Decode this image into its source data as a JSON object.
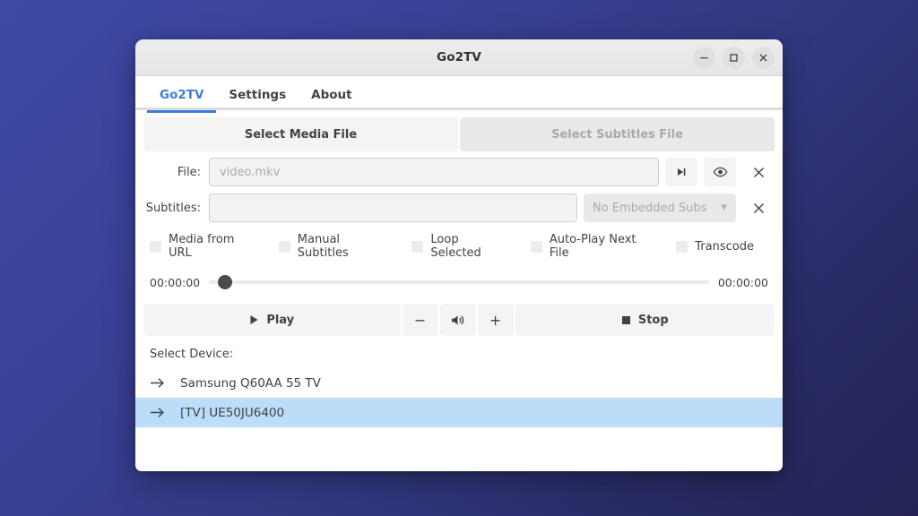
{
  "window": {
    "title": "Go2TV",
    "controls": [
      {
        "name": "minimize",
        "glyph": "minus"
      },
      {
        "name": "maximize",
        "glyph": "square"
      },
      {
        "name": "close",
        "glyph": "x"
      }
    ]
  },
  "tabs": [
    {
      "label": "Go2TV",
      "active": true
    },
    {
      "label": "Settings",
      "active": false
    },
    {
      "label": "About",
      "active": false
    }
  ],
  "segmented": {
    "media_button": "Select Media File",
    "subtitles_button": "Select Subtitles File"
  },
  "file_row": {
    "label": "File:",
    "value": "",
    "placeholder": "video.mkv",
    "buttons": [
      {
        "name": "skip-next-icon",
        "title": "skip-next"
      },
      {
        "name": "eye-icon",
        "title": "preview"
      },
      {
        "name": "clear-icon",
        "title": "clear"
      }
    ]
  },
  "subtitles_row": {
    "label": "Subtitles:",
    "value": "",
    "placeholder": "",
    "embedded_select": "No Embedded Subs",
    "clear_icon": "clear-icon"
  },
  "checkboxes": [
    {
      "label": "Media from URL",
      "checked": false
    },
    {
      "label": "Manual Subtitles",
      "checked": false
    },
    {
      "label": "Loop Selected",
      "checked": false
    },
    {
      "label": "Auto-Play Next File",
      "checked": false
    },
    {
      "label": "Transcode",
      "checked": false
    }
  ],
  "timeline": {
    "elapsed": "00:00:00",
    "total": "00:00:00",
    "position_percent": 0
  },
  "playback": {
    "play_label": "Play",
    "stop_label": "Stop",
    "volume_down": "−",
    "volume_icon": "volume-icon",
    "volume_up": "+"
  },
  "devices": {
    "label": "Select Device:",
    "items": [
      {
        "name": "Samsung Q60AA 55 TV",
        "selected": false
      },
      {
        "name": "[TV] UE50JU6400",
        "selected": true
      }
    ]
  },
  "colors": {
    "accent": "#3b7ddd",
    "selection": "#bcdcf8",
    "titlebar": "#ededed",
    "desktop_top": "#3d4aa7",
    "desktop_bottom": "#242354"
  }
}
